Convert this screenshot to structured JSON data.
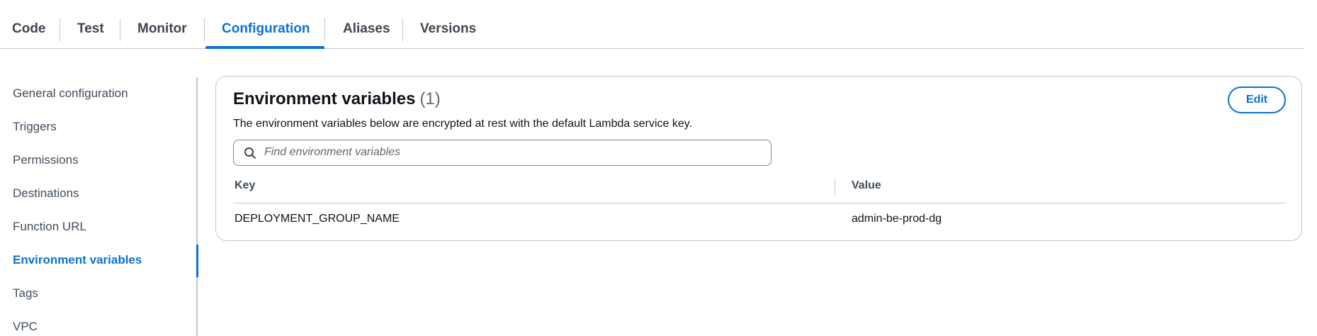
{
  "tabs": [
    {
      "label": "Code"
    },
    {
      "label": "Test"
    },
    {
      "label": "Monitor"
    },
    {
      "label": "Configuration",
      "active": true
    },
    {
      "label": "Aliases"
    },
    {
      "label": "Versions"
    }
  ],
  "sidebar": {
    "items": [
      {
        "label": "General configuration"
      },
      {
        "label": "Triggers"
      },
      {
        "label": "Permissions"
      },
      {
        "label": "Destinations"
      },
      {
        "label": "Function URL"
      },
      {
        "label": "Environment variables",
        "active": true
      },
      {
        "label": "Tags"
      },
      {
        "label": "VPC"
      }
    ]
  },
  "panel": {
    "title": "Environment variables",
    "count": "(1)",
    "description": "The environment variables below are encrypted at rest with the default Lambda service key.",
    "edit_label": "Edit",
    "search": {
      "placeholder": "Find environment variables",
      "value": ""
    },
    "table": {
      "headers": {
        "key": "Key",
        "value": "Value"
      },
      "rows": [
        {
          "key": "DEPLOYMENT_GROUP_NAME",
          "value": "admin-be-prod-dg"
        }
      ]
    }
  },
  "icons": {
    "search": "search-icon"
  },
  "colors": {
    "accent": "#0972d3",
    "text": "#0f141a",
    "muted": "#656871",
    "border": "#c6c6cd"
  }
}
